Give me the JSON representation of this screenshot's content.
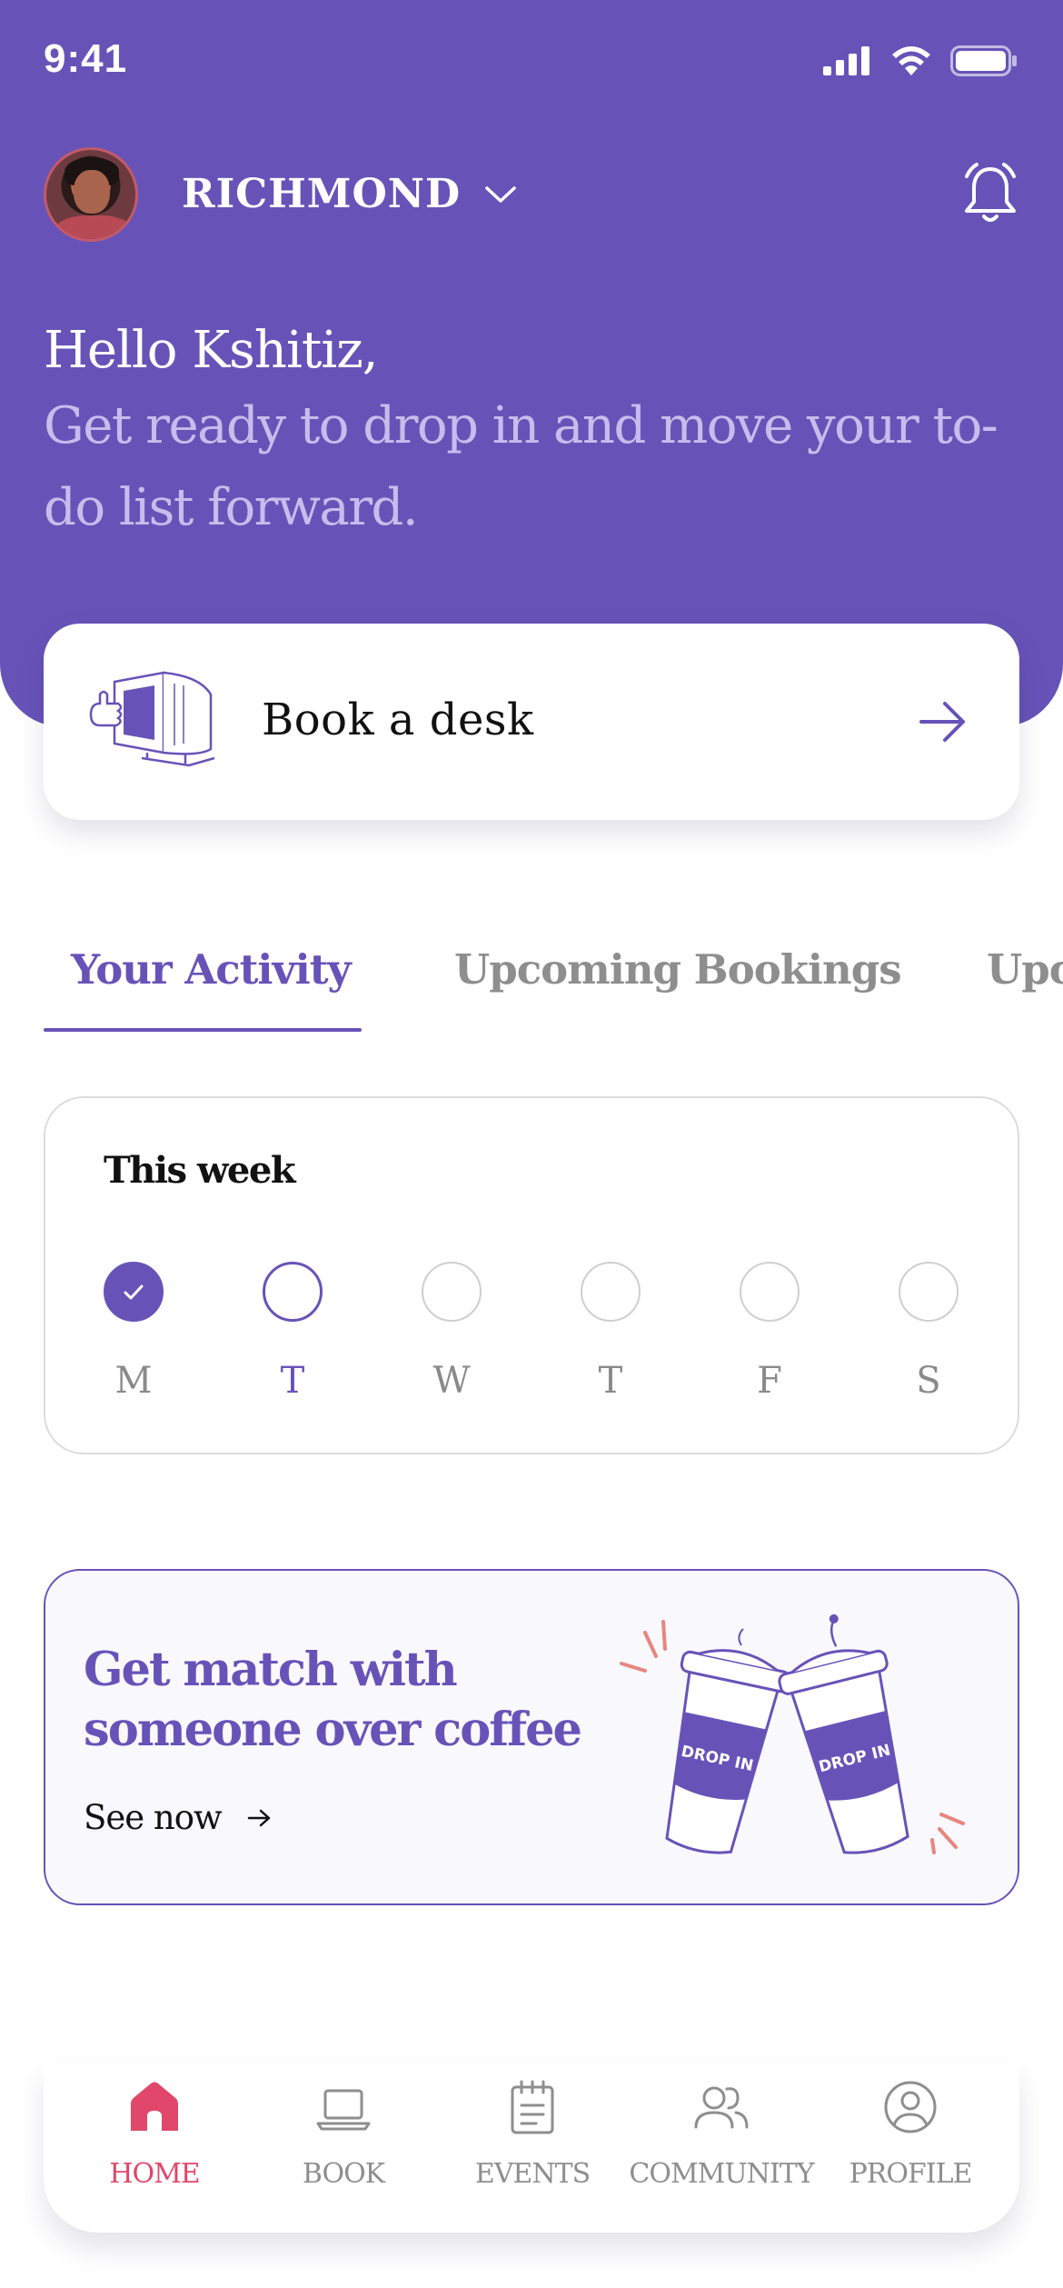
{
  "status_bar": {
    "time": "9:41"
  },
  "header": {
    "location": "RICHMOND",
    "greeting": "Hello Kshitiz,",
    "subtitle": "Get ready to drop in and move your to-do list forward."
  },
  "book_card": {
    "label": "Book a desk"
  },
  "tabs": [
    {
      "label": "Your Activity",
      "active": true
    },
    {
      "label": "Upcoming Bookings",
      "active": false
    },
    {
      "label": "Upc",
      "active": false
    }
  ],
  "week": {
    "title": "This week",
    "days": [
      {
        "letter": "M",
        "state": "done"
      },
      {
        "letter": "T",
        "state": "current"
      },
      {
        "letter": "W",
        "state": "empty"
      },
      {
        "letter": "T",
        "state": "empty"
      },
      {
        "letter": "F",
        "state": "empty"
      },
      {
        "letter": "S",
        "state": "empty"
      }
    ]
  },
  "promo": {
    "title": "Get match with someone over coffee",
    "link": "See now",
    "cup_label_1": "DROP IN",
    "cup_label_2": "DROP IN"
  },
  "bottom_nav": [
    {
      "label": "HOME",
      "icon": "home-icon",
      "active": true
    },
    {
      "label": "BOOK",
      "icon": "laptop-icon",
      "active": false
    },
    {
      "label": "EVENTS",
      "icon": "notepad-icon",
      "active": false
    },
    {
      "label": "COMMUNITY",
      "icon": "people-icon",
      "active": false
    },
    {
      "label": "PROFILE",
      "icon": "user-circle-icon",
      "active": false
    }
  ],
  "colors": {
    "brand_purple": "#6753b8",
    "accent_pink": "#e0476a",
    "muted_gray": "#8e8e8e",
    "subtitle_lilac": "#c7bceb"
  }
}
